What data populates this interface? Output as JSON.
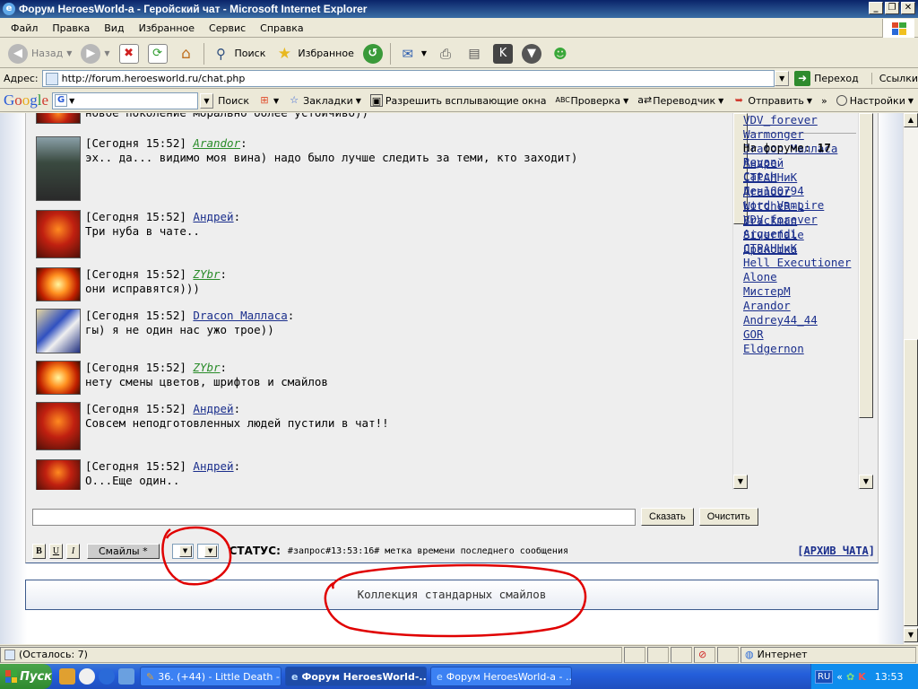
{
  "window": {
    "title": "Форум HeroesWorld-а - Геройский чат - Microsoft Internet Explorer",
    "controls": [
      "_",
      "❐",
      "✕"
    ]
  },
  "menu": [
    "Файл",
    "Правка",
    "Вид",
    "Избранное",
    "Сервис",
    "Справка"
  ],
  "toolbar": {
    "back": "Назад",
    "search": "Поиск",
    "favorites": "Избранное"
  },
  "address": {
    "label": "Адрес:",
    "url": "http://forum.heroesworld.ru/chat.php",
    "go": "Переход",
    "links": "Ссылки"
  },
  "google_bar": {
    "search_label": "Поиск",
    "bookmarks": "Закладки",
    "popups": "Разрешить всплывающие окна",
    "spell": "Проверка",
    "translate": "Переводчик",
    "send": "Отправить",
    "settings": "Настройки"
  },
  "messages": [
    {
      "time": "",
      "user": "",
      "user_style": "",
      "avatar": "demon",
      "text": "новое поколение морально более устойчиво))"
    },
    {
      "time": "[Сегодня 15:52]",
      "user": "Arandor",
      "user_style": "green",
      "avatar": "ranger",
      "text": "эх.. да... видимо моя вина) надо было лучше следить за теми, кто заходит)"
    },
    {
      "time": "[Сегодня 15:52]",
      "user": "Андрей",
      "user_style": "blue",
      "avatar": "demon",
      "text": "Три нуба в чате.."
    },
    {
      "time": "[Сегодня 15:52]",
      "user": "ZYbr",
      "user_style": "green",
      "avatar": "phoenix",
      "text": "они исправятся)))"
    },
    {
      "time": "[Сегодня 15:52]",
      "user": "Dracon Малласа",
      "user_style": "blue",
      "avatar": "mage",
      "text": "гы) я не один нас ужо трое))"
    },
    {
      "time": "[Сегодня 15:52]",
      "user": "ZYbr",
      "user_style": "green",
      "avatar": "phoenix",
      "text": "нету смены цветов, шрифтов и смайлов"
    },
    {
      "time": "[Сегодня 15:52]",
      "user": "Андрей",
      "user_style": "blue",
      "avatar": "demon",
      "text": "Совсем неподготовленных людей пустили в чат!!"
    },
    {
      "time": "[Сегодня 15:52]",
      "user": "Андрей",
      "user_style": "blue",
      "avatar": "demon",
      "text": "О...Еще один.."
    }
  ],
  "chat_users": [
    "VDV_forever",
    "Warmonger",
    "Dracon Малласа",
    "Андрей",
    "СТРАННиК",
    "Arandor",
    "WitcheR-L",
    "Brackman",
    "Siverfale",
    "Дракошка"
  ],
  "forum_online": {
    "label": "На форуме:",
    "count": "17",
    "users": [
      "Revan",
      "Catch",
      "Ден160794",
      "Lord Vampire",
      "VDV_forever",
      "Arquendi",
      "СТРАННиК",
      "Hell Executioner",
      "Alone",
      "МистерМ",
      "Arandor",
      "Andrey44_44",
      "GOR",
      "Eldgernon"
    ]
  },
  "chat_input": {
    "say": "Сказать",
    "clear": "Очистить"
  },
  "format": {
    "bold": "B",
    "underline": "U",
    "italic": "I",
    "smiles": "Смайлы *",
    "status_label": "СТАТУС:",
    "status_text": "#запрос#13:53:16# метка времени последнего сообщения",
    "archive": "АРХИВ ЧАТА"
  },
  "smile_collection": "Коллекция стандарных смайлов",
  "statusbar": {
    "remaining": "(Осталось: 7)",
    "zone": "Интернет"
  },
  "taskbar": {
    "start": "Пуск",
    "tasks": [
      {
        "label": "36. (+44) - Little Death -...",
        "active": false
      },
      {
        "label": "Форум HeroesWorld-...",
        "active": true
      },
      {
        "label": "Форум HeroesWorld-а - ...",
        "active": false
      }
    ],
    "lang": "RU",
    "clock": "13:53"
  },
  "colors": {
    "link_blue": "#1a2e8c",
    "link_green": "#2a8c2a",
    "annotation_red": "#e00000"
  }
}
